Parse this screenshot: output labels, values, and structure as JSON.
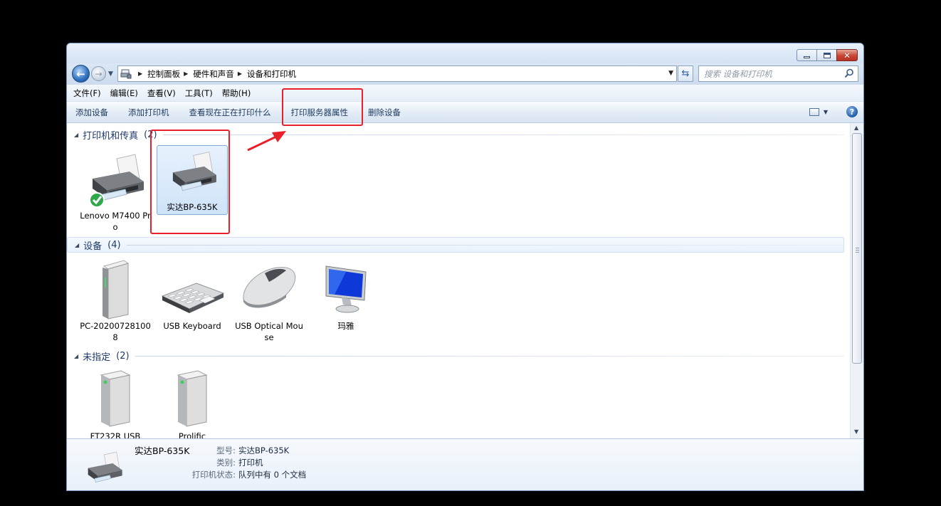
{
  "address_bar": {
    "breadcrumbs": [
      "控制面板",
      "硬件和声音",
      "设备和打印机"
    ],
    "search_placeholder": "搜索 设备和打印机"
  },
  "menu": [
    "文件(F)",
    "编辑(E)",
    "查看(V)",
    "工具(T)",
    "帮助(H)"
  ],
  "commands": [
    "添加设备",
    "添加打印机",
    "查看现在正在打印什么",
    "打印服务器属性",
    "删除设备"
  ],
  "groups": {
    "printers": {
      "title": "打印机和传真",
      "count": "(2)"
    },
    "devices": {
      "title": "设备",
      "count": "(4)"
    },
    "unspecified": {
      "title": "未指定",
      "count": "(2)"
    }
  },
  "printers": [
    {
      "label": "Lenovo M7400 Pro",
      "icon": "printer-icon",
      "default": true
    },
    {
      "label": "实达BP-635K",
      "icon": "printer-icon",
      "selected": true
    }
  ],
  "devices": [
    {
      "label": "PC-202007281008",
      "icon": "computer-tower-icon"
    },
    {
      "label": "USB Keyboard",
      "icon": "keyboard-icon"
    },
    {
      "label": "USB Optical Mouse",
      "icon": "mouse-icon"
    },
    {
      "label": "玛雅",
      "icon": "monitor-icon"
    }
  ],
  "unspecified": [
    {
      "label": "FT232R USB",
      "icon": "unspecified-device-icon"
    },
    {
      "label": "Prolific",
      "icon": "unspecified-device-icon"
    }
  ],
  "details": {
    "name": "实达BP-635K",
    "rows": [
      {
        "key": "型号:",
        "value": "实达BP-635K"
      },
      {
        "key": "类别:",
        "value": "打印机"
      },
      {
        "key": "打印机状态:",
        "value": "队列中有 0 个文档"
      }
    ]
  },
  "colors": {
    "annotation": "#e8202a",
    "group_title": "#1f3a6a",
    "selection": "#cfe3f8"
  }
}
